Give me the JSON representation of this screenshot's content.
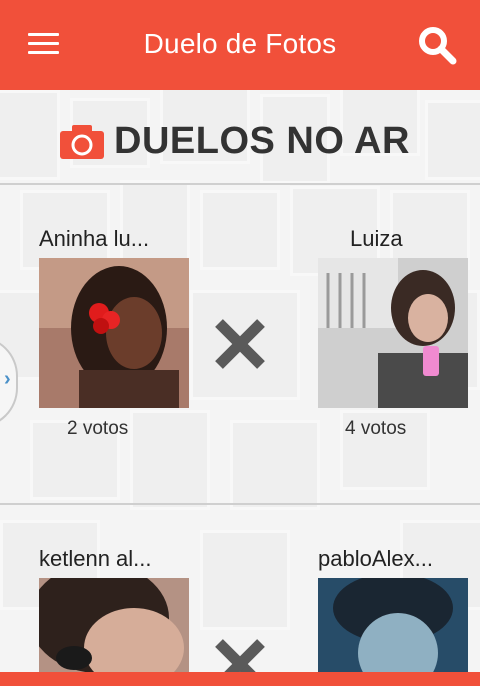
{
  "app": {
    "title": "Duelo de Fotos",
    "accent_color": "#f1503a",
    "menu_icon": "hamburger-menu-icon",
    "search_icon": "search-icon"
  },
  "section": {
    "icon": "camera-icon",
    "title": "DUELOS NO AR"
  },
  "duels": [
    {
      "left": {
        "name": "Aninha lu...",
        "votes": "2 votos"
      },
      "right": {
        "name": "Luiza",
        "votes": "4 votos"
      },
      "vs_icon": "versus-x-icon"
    },
    {
      "left": {
        "name": "ketlenn al..."
      },
      "right": {
        "name": "pabloAlex..."
      },
      "vs_icon": "versus-x-icon"
    }
  ],
  "side_tab": {
    "icon": "chevron-right-icon",
    "glyph": "›"
  }
}
